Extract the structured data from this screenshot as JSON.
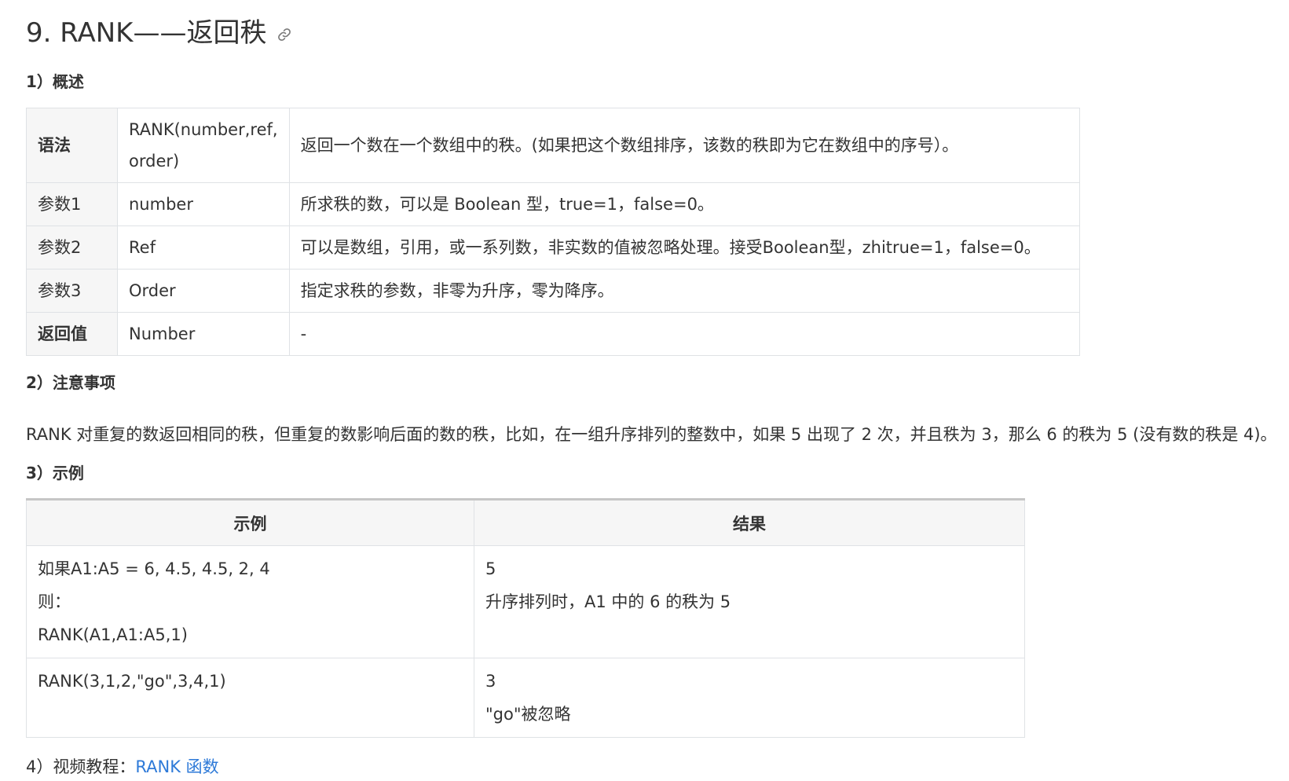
{
  "title": "9. RANK——返回秩",
  "sections": {
    "overview": "1）概述",
    "notes": "2）注意事项",
    "examples": "3）示例",
    "video_label": "4）视频教程：",
    "video_link": "RANK 函数"
  },
  "overview_table": [
    {
      "c1": "语法",
      "c1_bold": true,
      "c2": "RANK(number,ref,",
      "c2b": "order)",
      "c3": "返回一个数在一个数组中的秩。(如果把这个数组排序，该数的秩即为它在数组中的序号）。"
    },
    {
      "c1": "参数1",
      "c2": "number",
      "c3": "所求秩的数，可以是 Boolean 型，true=1，false=0。"
    },
    {
      "c1": "参数2",
      "c2": "Ref",
      "c3": "可以是数组，引用，或一系列数，非实数的值被忽略处理。接受Boolean型，zhitrue=1，false=0。"
    },
    {
      "c1": "参数3",
      "c2": "Order",
      "c3": "指定求秩的参数，非零为升序，零为降序。"
    },
    {
      "c1": "返回值",
      "c1_bold": true,
      "c2": "Number",
      "c3": "-"
    }
  ],
  "note_text": "RANK 对重复的数返回相同的秩，但重复的数影响后面的数的秩，比如，在一组升序排列的整数中，如果 5 出现了 2 次，并且秩为 3，那么 6 的秩为 5 (没有数的秩是 4)。",
  "example_table": {
    "headers": [
      "示例",
      "结果"
    ],
    "rows": [
      {
        "example": [
          "如果A1:A5 = 6, 4.5, 4.5, 2, 4",
          "则：",
          "RANK(A1,A1:A5,1)"
        ],
        "result": [
          "5",
          "升序排列时，A1 中的 6 的秩为 5"
        ]
      },
      {
        "example": [
          "RANK(3,1,2,\"go\",3,4,1)"
        ],
        "result": [
          "3",
          "\"go\"被忽略"
        ]
      }
    ]
  }
}
